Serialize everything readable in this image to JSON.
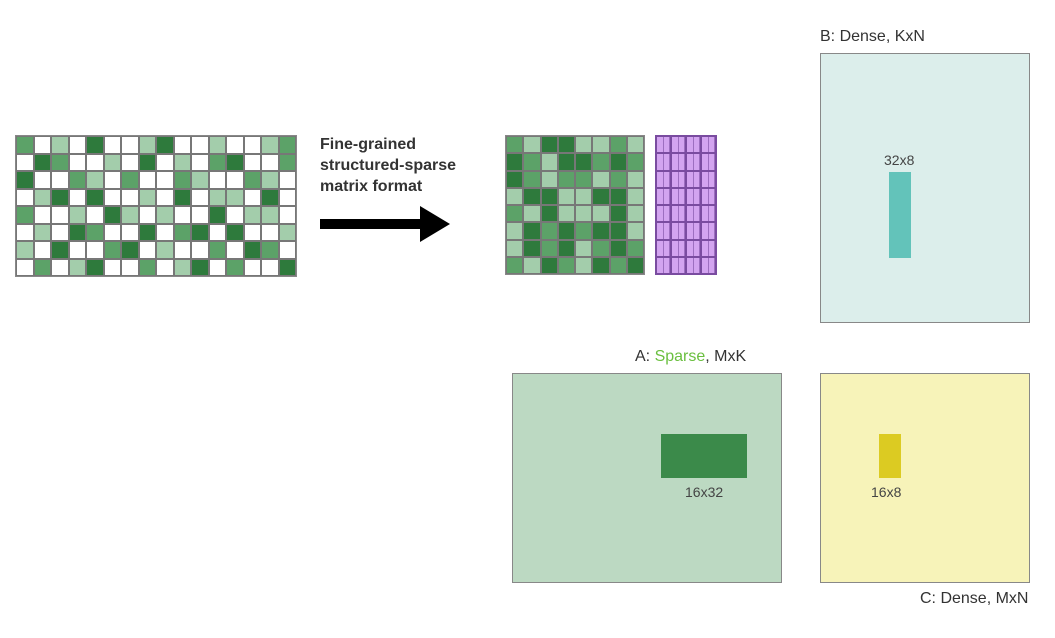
{
  "arrow_caption": {
    "line1": "Fine-grained",
    "line2": "structured-sparse",
    "line3": "matrix format"
  },
  "matrix_B": {
    "label_prefix": "B: Dense, ",
    "label_dims": "KxN",
    "inner_label": "32x8",
    "bg_color": "#dceeeb",
    "inner_color": "#63c3ba"
  },
  "matrix_A": {
    "label_prefix": "A: ",
    "label_sparse": "Sparse",
    "label_suffix": ", MxK",
    "inner_label": "16x32",
    "bg_color": "#bcd9c2",
    "inner_color": "#3b8a4a"
  },
  "matrix_C": {
    "label_prefix": "C: Dense, ",
    "label_dims": "MxN",
    "inner_label": "16x8",
    "bg_color": "#f7f3b9",
    "inner_color": "#dccb22"
  },
  "chart_data": {
    "type": "table",
    "description": "Sparse matrix multiply illustration: A (MxK sparse, 2:4 fine-grained structured sparsity) × B (KxN dense) = C (MxN dense). Tensor-core tile sizes shown as 16x32, 32x8, 16x8.",
    "sparse_pattern_rows_cols": [
      8,
      16
    ],
    "sparse_pattern": [
      "mwlwdwwldwwlwwlm",
      "wdmwwlwdwlwmdwwm",
      "dwwmlwmwwmlwwmlw",
      "wldwdwwlwdwllwdw",
      "mwwlwdlwlwwdwllw",
      "wlwdmwwdwmdwdwwl",
      "lwdwwmdwlwwmwdmw",
      "wmwldwwmwldwmwwd"
    ],
    "dense_compressed_rows_cols": [
      8,
      8
    ],
    "dense_compressed": [
      "mlddllml",
      "dmlddmdm",
      "dmlmmlml",
      "lddllddl",
      "mldllldl",
      "ldmdmddl",
      "ldmdlmdm",
      "mldmldmd"
    ],
    "legend": {
      "w": "empty",
      "l": "light-green",
      "m": "mid-green",
      "d": "dark-green"
    },
    "tiles": {
      "A": "16x32",
      "B": "32x8",
      "C": "16x8"
    }
  }
}
